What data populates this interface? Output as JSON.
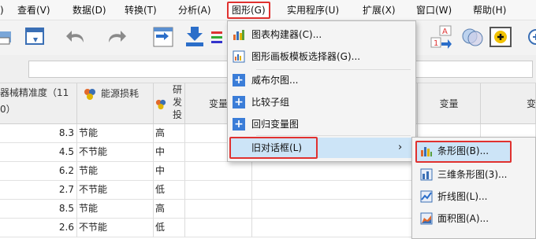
{
  "menubar": {
    "items": [
      "查看(V)",
      "数据(D)",
      "转换(T)",
      "分析(A)",
      "图形(G)",
      "实用程序(U)",
      "扩展(X)",
      "窗口(W)",
      "帮助(H)"
    ]
  },
  "grid": {
    "headers": {
      "col1": "器械精准度（11\n0）",
      "col2": "能源损耗",
      "col3": "研\n发\n投",
      "var1": "变量",
      "var2": "变量",
      "var3": "变"
    },
    "rows": [
      {
        "precision": "8.3",
        "energy": "节能",
        "rnd": "高"
      },
      {
        "precision": "4.5",
        "energy": "不节能",
        "rnd": "中"
      },
      {
        "precision": "6.2",
        "energy": "节能",
        "rnd": "中"
      },
      {
        "precision": "2.7",
        "energy": "不节能",
        "rnd": "低"
      },
      {
        "precision": "8.5",
        "energy": "节能",
        "rnd": "高"
      },
      {
        "precision": "2.6",
        "energy": "不节能",
        "rnd": "低"
      }
    ]
  },
  "graph_menu": {
    "items": [
      {
        "label": "图表构建器(C)...",
        "icon": "chart-builder-icon"
      },
      {
        "label": "图形画板模板选择器(G)...",
        "icon": "template-chooser-icon"
      },
      {
        "label": "威布尔图...",
        "icon": "plus-icon"
      },
      {
        "label": "比较子组",
        "icon": "plus-icon"
      },
      {
        "label": "回归变量图",
        "icon": "plus-icon"
      },
      {
        "label": "旧对话框(L)",
        "arrow": "›"
      }
    ]
  },
  "legacy_submenu": {
    "items": [
      {
        "label": "条形图(B)...",
        "icon": "bar-chart-icon"
      },
      {
        "label": "三维条形图(3)...",
        "icon": "3d-bar-chart-icon"
      },
      {
        "label": "折线图(L)...",
        "icon": "line-chart-icon"
      },
      {
        "label": "面积图(A)...",
        "icon": "area-chart-icon"
      }
    ]
  },
  "colors": {
    "highlight_red": "#e0312f",
    "hover_blue": "#cce4f7",
    "accent_blue": "#3b7dd8"
  }
}
